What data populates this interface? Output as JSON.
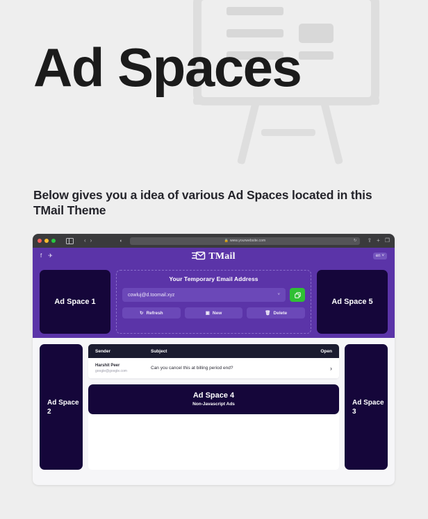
{
  "hero": {
    "title": "Ad Spaces",
    "subtitle": "Below gives you a idea of various Ad Spaces located in this TMail Theme",
    "illustration_icon": "presentation-board-easel-icon"
  },
  "browser": {
    "url": "www.yourwebsite.com",
    "lock_icon": "lock-icon",
    "reload_icon": "reload-icon",
    "sidebar_icon": "sidebar-toggle-icon",
    "back_icon": "chevron-left-icon",
    "forward_icon": "chevron-right-icon",
    "appearance_icon": "half-circle-icon",
    "share_icon": "share-icon",
    "newtab_icon": "plus-icon",
    "tabs_icon": "copy-tabs-icon",
    "traffic_lights": [
      "close-red",
      "minimize-yellow",
      "zoom-green"
    ]
  },
  "mail_header": {
    "brand": "TMail",
    "brand_icon": "envelope-send-icon",
    "social": [
      {
        "name": "facebook-icon",
        "glyph": "f"
      },
      {
        "name": "twitter-icon",
        "glyph": "✈"
      }
    ],
    "language": "en",
    "language_caret": "˅",
    "panel_title": "Your Temporary Email Address",
    "email_value": "cowluj@d.toomail.xyz",
    "dropdown_caret": "˅",
    "copy_icon": "copy-icon",
    "buttons": [
      {
        "label": "Refresh",
        "icon": "refresh-icon",
        "glyph": "↻"
      },
      {
        "label": "New",
        "icon": "new-icon",
        "glyph": "▣"
      },
      {
        "label": "Delete",
        "icon": "trash-icon",
        "glyph": "🗑"
      }
    ]
  },
  "inbox": {
    "columns": {
      "sender": "Sender",
      "subject": "Subject",
      "open": "Open"
    },
    "rows": [
      {
        "sender_name": "Harshit Peer",
        "sender_email": "google@google.com",
        "subject": "Can you cancel this at billing period end?",
        "open_icon": "chevron-right-icon"
      }
    ]
  },
  "ad_spaces": {
    "ad1": {
      "label": "Ad Space 1"
    },
    "ad2": {
      "label": "Ad Space 2"
    },
    "ad3": {
      "label": "Ad Space 3"
    },
    "ad4": {
      "label": "Ad Space 4",
      "sublabel": "Non-Javascript Ads"
    },
    "ad5": {
      "label": "Ad Space 5"
    }
  },
  "colors": {
    "page_bg": "#eeeeee",
    "brand_purple": "#5b34a8",
    "ad_navy": "#15063a",
    "table_header": "#1b1c30",
    "accent_green": "#2fbf34",
    "illustration_gray": "#dedede"
  }
}
